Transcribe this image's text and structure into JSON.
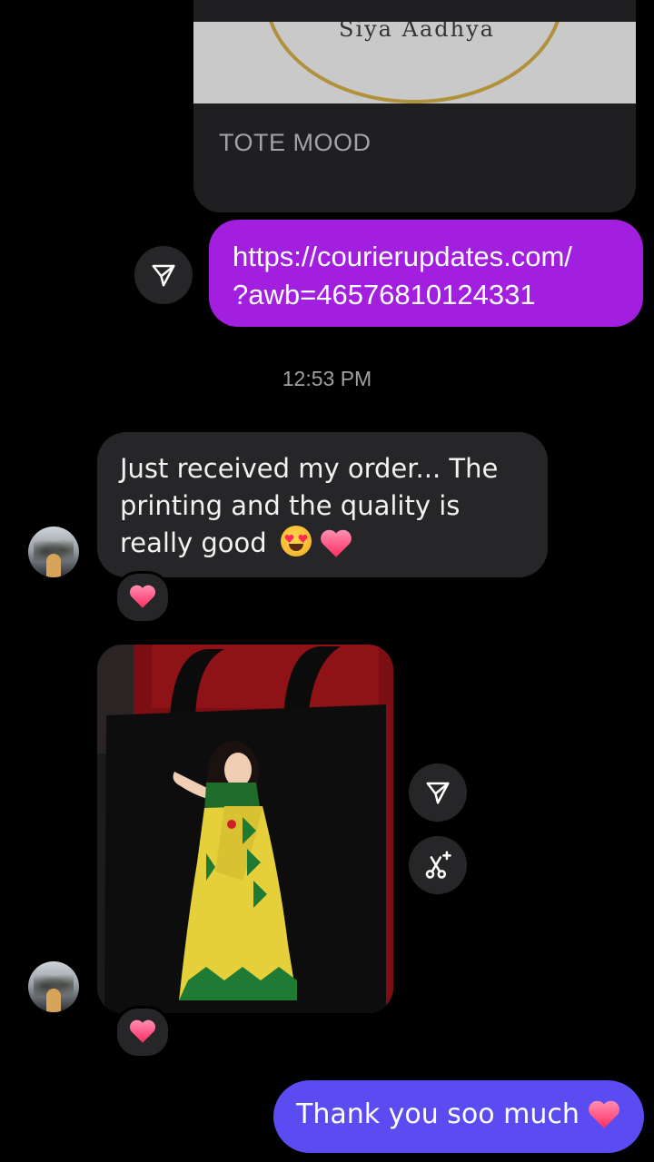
{
  "shared_card": {
    "title": "TOTE MOOD",
    "preview_script": "Siya Aadhya"
  },
  "outgoing_link": {
    "line1": "https://courierupdates.com/",
    "line2": "?awb=46576810124331"
  },
  "timestamp": "12:53 PM",
  "incoming_message": {
    "text": "Just received my order... The printing and the quality is really good",
    "emojis": [
      "heart-eyes-emoji",
      "pink-heart-emoji"
    ]
  },
  "reactions": {
    "message_reaction": "pink-heart-emoji",
    "image_reaction": "pink-heart-emoji"
  },
  "image_message": {
    "subject": "black tote bag with printed illustration of a woman in yellow saree"
  },
  "outgoing_thanks": {
    "text": "Thank you soo much",
    "emoji": "pink-heart-emoji"
  },
  "icons": {
    "share": "share-icon",
    "ai_edit": "ai-restyle-icon"
  },
  "colors": {
    "background": "#000000",
    "incoming_bubble": "#262628",
    "outgoing_link_bubble": "#a21fe0",
    "outgoing_thanks_bubble": "#5a4cf0",
    "heart": "#ff4d78",
    "timestamp_text": "#a0a0a0"
  }
}
